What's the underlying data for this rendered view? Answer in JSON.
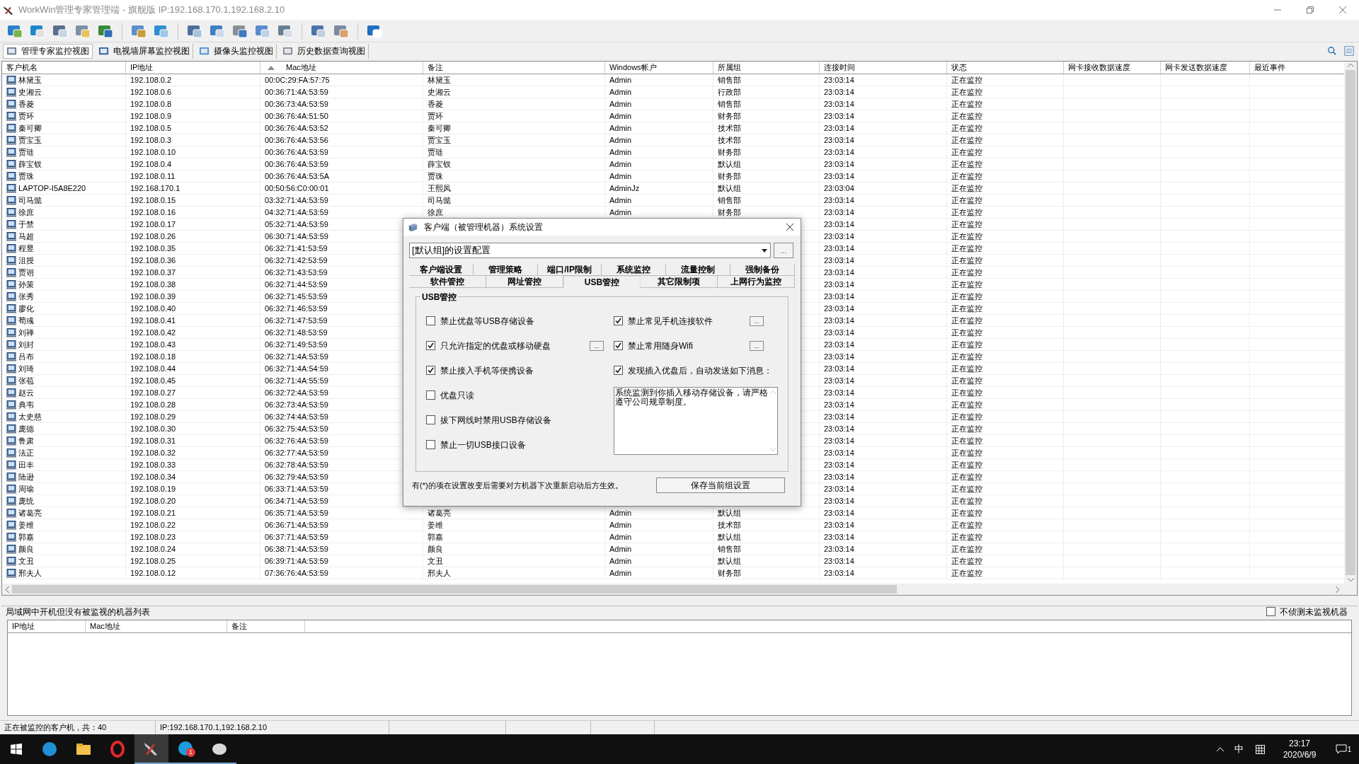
{
  "window": {
    "title": "WorkWin管理专家管理端 - 旗舰版 IP:192.168.170.1,192.168.2.10"
  },
  "view_tabs": [
    {
      "label": "管理专家监控视图",
      "selected": true
    },
    {
      "label": "电视墙屏幕监控视图",
      "selected": false
    },
    {
      "label": "摄像头监控视图",
      "selected": false
    },
    {
      "label": "历史数据查询视图",
      "selected": false
    }
  ],
  "table": {
    "columns": [
      {
        "label": "客户机名",
        "sorted": false
      },
      {
        "label": "IP地址",
        "sorted": false
      },
      {
        "label": "Mac地址",
        "sorted": true
      },
      {
        "label": "备注",
        "sorted": false
      },
      {
        "label": "Windows帐户",
        "sorted": false
      },
      {
        "label": "所属组",
        "sorted": false
      },
      {
        "label": "连接时间",
        "sorted": false
      },
      {
        "label": "状态",
        "sorted": false
      },
      {
        "label": "网卡接收数据速度",
        "sorted": false
      },
      {
        "label": "网卡发送数据速度",
        "sorted": false
      },
      {
        "label": "最近事件",
        "sorted": false
      }
    ],
    "rows": [
      {
        "name": "林黛玉",
        "ip": "192.108.0.2",
        "mac": "00:0C:29:FA:57:75",
        "note": "林黛玉",
        "account": "Admin",
        "group": "销售部",
        "time": "23:03:14",
        "status": "正在监控"
      },
      {
        "name": "史湘云",
        "ip": "192.108.0.6",
        "mac": "00:36:71:4A:53:59",
        "note": "史湘云",
        "account": "Admin",
        "group": "行政部",
        "time": "23:03:14",
        "status": "正在监控"
      },
      {
        "name": "香菱",
        "ip": "192.108.0.8",
        "mac": "00:36:73:4A:53:59",
        "note": "香菱",
        "account": "Admin",
        "group": "销售部",
        "time": "23:03:14",
        "status": "正在监控"
      },
      {
        "name": "贾环",
        "ip": "192.108.0.9",
        "mac": "00:36:76:4A:51:50",
        "note": "贾环",
        "account": "Admin",
        "group": "财务部",
        "time": "23:03:14",
        "status": "正在监控"
      },
      {
        "name": "秦可卿",
        "ip": "192.108.0.5",
        "mac": "00:36:76:4A:53:52",
        "note": "秦可卿",
        "account": "Admin",
        "group": "技术部",
        "time": "23:03:14",
        "status": "正在监控"
      },
      {
        "name": "贾宝玉",
        "ip": "192.108.0.3",
        "mac": "00:36:76:4A:53:56",
        "note": "贾宝玉",
        "account": "Admin",
        "group": "技术部",
        "time": "23:03:14",
        "status": "正在监控"
      },
      {
        "name": "贾琏",
        "ip": "192.108.0.10",
        "mac": "00:36:76:4A:53:59",
        "note": "贾琏",
        "account": "Admin",
        "group": "财务部",
        "time": "23:03:14",
        "status": "正在监控"
      },
      {
        "name": "薛宝钗",
        "ip": "192.108.0.4",
        "mac": "00:36:76:4A:53:59",
        "note": "薛宝钗",
        "account": "Admin",
        "group": "默认组",
        "time": "23:03:14",
        "status": "正在监控"
      },
      {
        "name": "贾珠",
        "ip": "192.108.0.11",
        "mac": "00:36:76:4A:53:5A",
        "note": "贾珠",
        "account": "Admin",
        "group": "财务部",
        "time": "23:03:14",
        "status": "正在监控"
      },
      {
        "name": "LAPTOP-I5A8E220",
        "ip": "192.168.170.1",
        "mac": "00:50:56:C0:00:01",
        "note": "王熙凤",
        "account": "AdminJz",
        "group": "默认组",
        "time": "23:03:04",
        "status": "正在监控"
      },
      {
        "name": "司马懿",
        "ip": "192.108.0.15",
        "mac": "03:32:71:4A:53:59",
        "note": "司马懿",
        "account": "Admin",
        "group": "销售部",
        "time": "23:03:14",
        "status": "正在监控"
      },
      {
        "name": "徐庶",
        "ip": "192.108.0.16",
        "mac": "04:32:71:4A:53:59",
        "note": "徐庶",
        "account": "Admin",
        "group": "财务部",
        "time": "23:03:14",
        "status": "正在监控"
      },
      {
        "name": "于禁",
        "ip": "192.108.0.17",
        "mac": "05:32:71:4A:53:59",
        "time": "23:03:14",
        "status": "正在监控"
      },
      {
        "name": "马超",
        "ip": "192.108.0.26",
        "mac": "06:30:71:4A:53:59",
        "time": "23:03:14",
        "status": "正在监控"
      },
      {
        "name": "程昱",
        "ip": "192.108.0.35",
        "mac": "06:32:71:41:53:59",
        "time": "23:03:14",
        "status": "正在监控"
      },
      {
        "name": "沮授",
        "ip": "192.108.0.36",
        "mac": "06:32:71:42:53:59",
        "time": "23:03:14",
        "status": "正在监控"
      },
      {
        "name": "贾诩",
        "ip": "192.108.0.37",
        "mac": "06:32:71:43:53:59",
        "time": "23:03:14",
        "status": "正在监控"
      },
      {
        "name": "孙策",
        "ip": "192.108.0.38",
        "mac": "06:32:71:44:53:59",
        "time": "23:03:14",
        "status": "正在监控"
      },
      {
        "name": "张秀",
        "ip": "192.108.0.39",
        "mac": "06:32:71:45:53:59",
        "time": "23:03:14",
        "status": "正在监控"
      },
      {
        "name": "廖化",
        "ip": "192.108.0.40",
        "mac": "06:32:71:46:53:59",
        "time": "23:03:14",
        "status": "正在监控"
      },
      {
        "name": "荀彧",
        "ip": "192.108.0.41",
        "mac": "06:32:71:47:53:59",
        "time": "23:03:14",
        "status": "正在监控"
      },
      {
        "name": "刘禅",
        "ip": "192.108.0.42",
        "mac": "06:32:71:48:53:59",
        "time": "23:03:14",
        "status": "正在监控"
      },
      {
        "name": "刘封",
        "ip": "192.108.0.43",
        "mac": "06:32:71:49:53:59",
        "time": "23:03:14",
        "status": "正在监控"
      },
      {
        "name": "吕布",
        "ip": "192.108.0.18",
        "mac": "06:32:71:4A:53:59",
        "time": "23:03:14",
        "status": "正在监控"
      },
      {
        "name": "刘琦",
        "ip": "192.108.0.44",
        "mac": "06:32:71:4A:54:59",
        "time": "23:03:14",
        "status": "正在监控"
      },
      {
        "name": "张苞",
        "ip": "192.108.0.45",
        "mac": "06:32:71:4A:55:59",
        "time": "23:03:14",
        "status": "正在监控"
      },
      {
        "name": "赵云",
        "ip": "192.108.0.27",
        "mac": "06:32:72:4A:53:59",
        "time": "23:03:14",
        "status": "正在监控"
      },
      {
        "name": "典韦",
        "ip": "192.108.0.28",
        "mac": "06:32:73:4A:53:59",
        "time": "23:03:14",
        "status": "正在监控"
      },
      {
        "name": "太史慈",
        "ip": "192.108.0.29",
        "mac": "06:32:74:4A:53:59",
        "time": "23:03:14",
        "status": "正在监控"
      },
      {
        "name": "庞德",
        "ip": "192.108.0.30",
        "mac": "06:32:75:4A:53:59",
        "time": "23:03:14",
        "status": "正在监控"
      },
      {
        "name": "鲁肃",
        "ip": "192.108.0.31",
        "mac": "06:32:76:4A:53:59",
        "time": "23:03:14",
        "status": "正在监控"
      },
      {
        "name": "法正",
        "ip": "192.108.0.32",
        "mac": "06:32:77:4A:53:59",
        "time": "23:03:14",
        "status": "正在监控"
      },
      {
        "name": "田丰",
        "ip": "192.108.0.33",
        "mac": "06:32:78:4A:53:59",
        "time": "23:03:14",
        "status": "正在监控"
      },
      {
        "name": "陆逊",
        "ip": "192.108.0.34",
        "mac": "06:32:79:4A:53:59",
        "time": "23:03:14",
        "status": "正在监控"
      },
      {
        "name": "周瑜",
        "ip": "192.108.0.19",
        "mac": "06:33:71:4A:53:59",
        "time": "23:03:14",
        "status": "正在监控"
      },
      {
        "name": "庞统",
        "ip": "192.108.0.20",
        "mac": "06:34:71:4A:53:59",
        "time": "23:03:14",
        "status": "正在监控"
      },
      {
        "name": "诸葛亮",
        "ip": "192.108.0.21",
        "mac": "06:35:71:4A:53:59",
        "note": "诸葛亮",
        "account": "Admin",
        "group": "默认组",
        "time": "23:03:14",
        "status": "正在监控"
      },
      {
        "name": "姜维",
        "ip": "192.108.0.22",
        "mac": "06:36:71:4A:53:59",
        "note": "姜维",
        "account": "Admin",
        "group": "技术部",
        "time": "23:03:14",
        "status": "正在监控"
      },
      {
        "name": "郭嘉",
        "ip": "192.108.0.23",
        "mac": "06:37:71:4A:53:59",
        "note": "郭嘉",
        "account": "Admin",
        "group": "默认组",
        "time": "23:03:14",
        "status": "正在监控"
      },
      {
        "name": "颜良",
        "ip": "192.108.0.24",
        "mac": "06:38:71:4A:53:59",
        "note": "颜良",
        "account": "Admin",
        "group": "销售部",
        "time": "23:03:14",
        "status": "正在监控"
      },
      {
        "name": "文丑",
        "ip": "192.108.0.25",
        "mac": "06:39:71:4A:53:59",
        "note": "文丑",
        "account": "Admin",
        "group": "默认组",
        "time": "23:03:14",
        "status": "正在监控"
      },
      {
        "name": "邢夫人",
        "ip": "192.108.0.12",
        "mac": "07:36:76:4A:53:59",
        "note": "邢夫人",
        "account": "Admin",
        "group": "财务部",
        "time": "23:03:14",
        "status": "正在监控"
      }
    ]
  },
  "dialog": {
    "title": "客户端（被管理机器）系统设置",
    "profile": "[默认组]的设置配置",
    "profile_button": "...",
    "tab_rows": [
      [
        {
          "label": "客户端设置",
          "selected": false
        },
        {
          "label": "管理策略",
          "selected": false
        },
        {
          "label": "端口/IP限制",
          "selected": false
        },
        {
          "label": "系统监控",
          "selected": false
        },
        {
          "label": "流量控制",
          "selected": false
        },
        {
          "label": "强制备份",
          "selected": false
        }
      ],
      [
        {
          "label": "软件管控",
          "selected": false
        },
        {
          "label": "网址管控",
          "selected": false
        },
        {
          "label": "USB管控",
          "selected": true
        },
        {
          "label": "其它限制项",
          "selected": false
        },
        {
          "label": "上网行为监控",
          "selected": false
        }
      ]
    ],
    "group_title": "USB管控",
    "left_options": [
      {
        "label": "禁止优盘等USB存储设备",
        "checked": false
      },
      {
        "label": "只允许指定的优盘或移动硬盘",
        "checked": true,
        "button": "..."
      },
      {
        "label": "禁止接入手机等便携设备",
        "checked": true
      },
      {
        "label": "优盘只读",
        "checked": false
      },
      {
        "label": "拔下网线时禁用USB存储设备",
        "checked": false
      },
      {
        "label": "禁止一切USB接口设备",
        "checked": false
      }
    ],
    "right_options": [
      {
        "label": "禁止常见手机连接软件",
        "checked": true,
        "button": "..."
      },
      {
        "label": "禁止常用随身Wifi",
        "checked": true,
        "button": "..."
      },
      {
        "label": "发现插入优盘后，自动发送如下消息：",
        "checked": true
      }
    ],
    "message": "系统监测到你插入移动存储设备，请严格遵守公司规章制度。",
    "note": "有(*)的项在设置改变后需要对方机器下次重新启动后方生效。",
    "save_button": "保存当前组设置"
  },
  "bottom_panel": {
    "title": "局域网中开机但没有被监视的机器列表",
    "option": {
      "label": "不侦测未监视机器",
      "checked": false
    },
    "columns": [
      "IP地址",
      "Mac地址",
      "备注"
    ]
  },
  "status_bar": [
    "正在被监控的客户机，共：40",
    "IP:192.168.170.1,192.168.2.10"
  ],
  "taskbar": {
    "app_badge": "1",
    "ime": "中",
    "time": "23:17",
    "date": "2020/6/9",
    "notification_count": "1"
  }
}
